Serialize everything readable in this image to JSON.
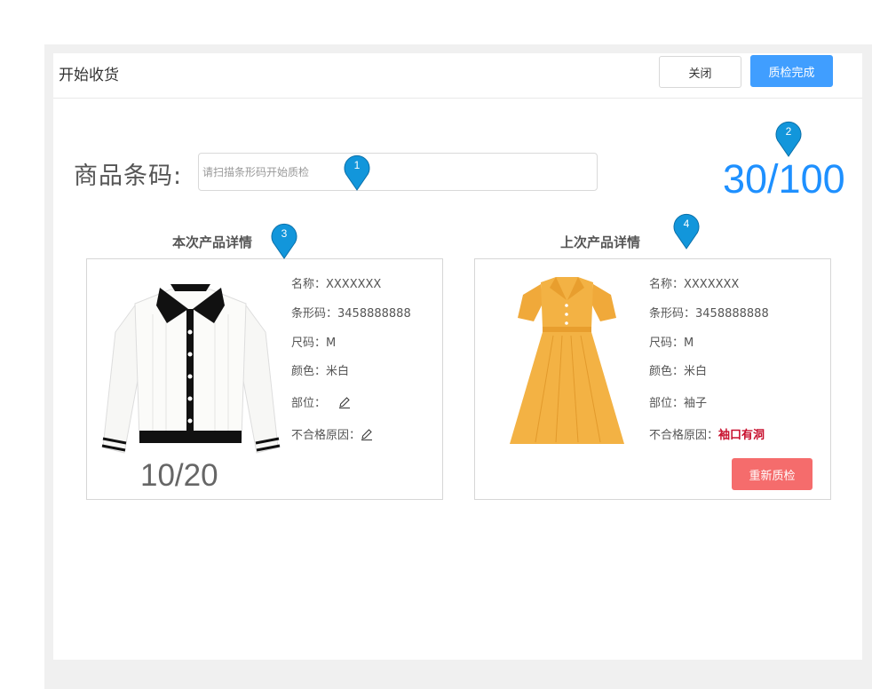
{
  "header": {
    "title": "开始收货",
    "close_label": "关闭",
    "done_label": "质检完成"
  },
  "barcode": {
    "label": "商品条码:",
    "placeholder": "请扫描条形码开始质检"
  },
  "counter": "30/100",
  "markers": [
    "1",
    "2",
    "3",
    "4"
  ],
  "current_product": {
    "section_title": "本次产品详情",
    "name": "名称：XXXXXXX",
    "barcode": "条形码：3458888888",
    "size": "尺码：M",
    "color": "颜色：米白",
    "part": "部位：",
    "reason": "不合格原因：",
    "count": "10/20"
  },
  "previous_product": {
    "section_title": "上次产品详情",
    "name": "名称：XXXXXXX",
    "barcode": "条形码：3458888888",
    "size": "尺码：M",
    "color": "颜色：米白",
    "part": "部位：袖子",
    "reason_label": "不合格原因：",
    "reason_value": "袖口有洞",
    "recheck_label": "重新质检"
  },
  "colors": {
    "primary": "#409eff",
    "counter": "#1e90ff",
    "danger_button": "#f56c6c",
    "defect_text": "#c8102e",
    "marker": "#1296db"
  }
}
